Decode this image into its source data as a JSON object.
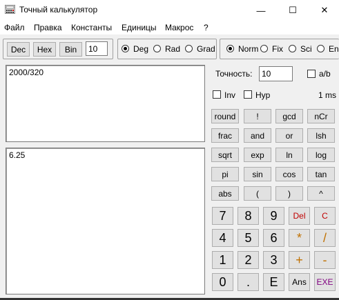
{
  "window": {
    "title": "Точный калькулятор",
    "minimize_glyph": "—",
    "maximize_glyph": "☐",
    "close_glyph": "✕"
  },
  "menu": [
    "Файл",
    "Правка",
    "Константы",
    "Единицы",
    "Макрос",
    "?"
  ],
  "toolbar": {
    "base_buttons": [
      "Dec",
      "Hex",
      "Bin"
    ],
    "base_value": "10",
    "angle_options": [
      "Deg",
      "Rad",
      "Grad"
    ],
    "angle_selected": "Deg",
    "format_options": [
      "Norm",
      "Fix",
      "Sci",
      "Eng"
    ],
    "format_selected": "Norm"
  },
  "expression": "2000/320",
  "result": "6.25",
  "precision": {
    "label": "Точность:",
    "value": "10"
  },
  "options": {
    "ab_label": "a/b",
    "inv_label": "Inv",
    "hyp_label": "Hyp",
    "timing": "1 ms"
  },
  "function_rows": [
    [
      "round",
      "!",
      "gcd",
      "nCr"
    ],
    [
      "frac",
      "and",
      "or",
      "lsh"
    ],
    [
      "sqrt",
      "exp",
      "ln",
      "log"
    ],
    [
      "pi",
      "sin",
      "cos",
      "tan"
    ],
    [
      "abs",
      "(",
      ")",
      "^"
    ]
  ],
  "keypad_rows": [
    [
      "7",
      "8",
      "9",
      "Del",
      "C"
    ],
    [
      "4",
      "5",
      "6",
      "*",
      "/"
    ],
    [
      "1",
      "2",
      "3",
      "+",
      "-"
    ],
    [
      "0",
      ".",
      "E",
      "Ans",
      "EXE"
    ]
  ],
  "colors": {
    "delete": "#c00000",
    "operator": "#c07000",
    "exe": "#800080"
  }
}
